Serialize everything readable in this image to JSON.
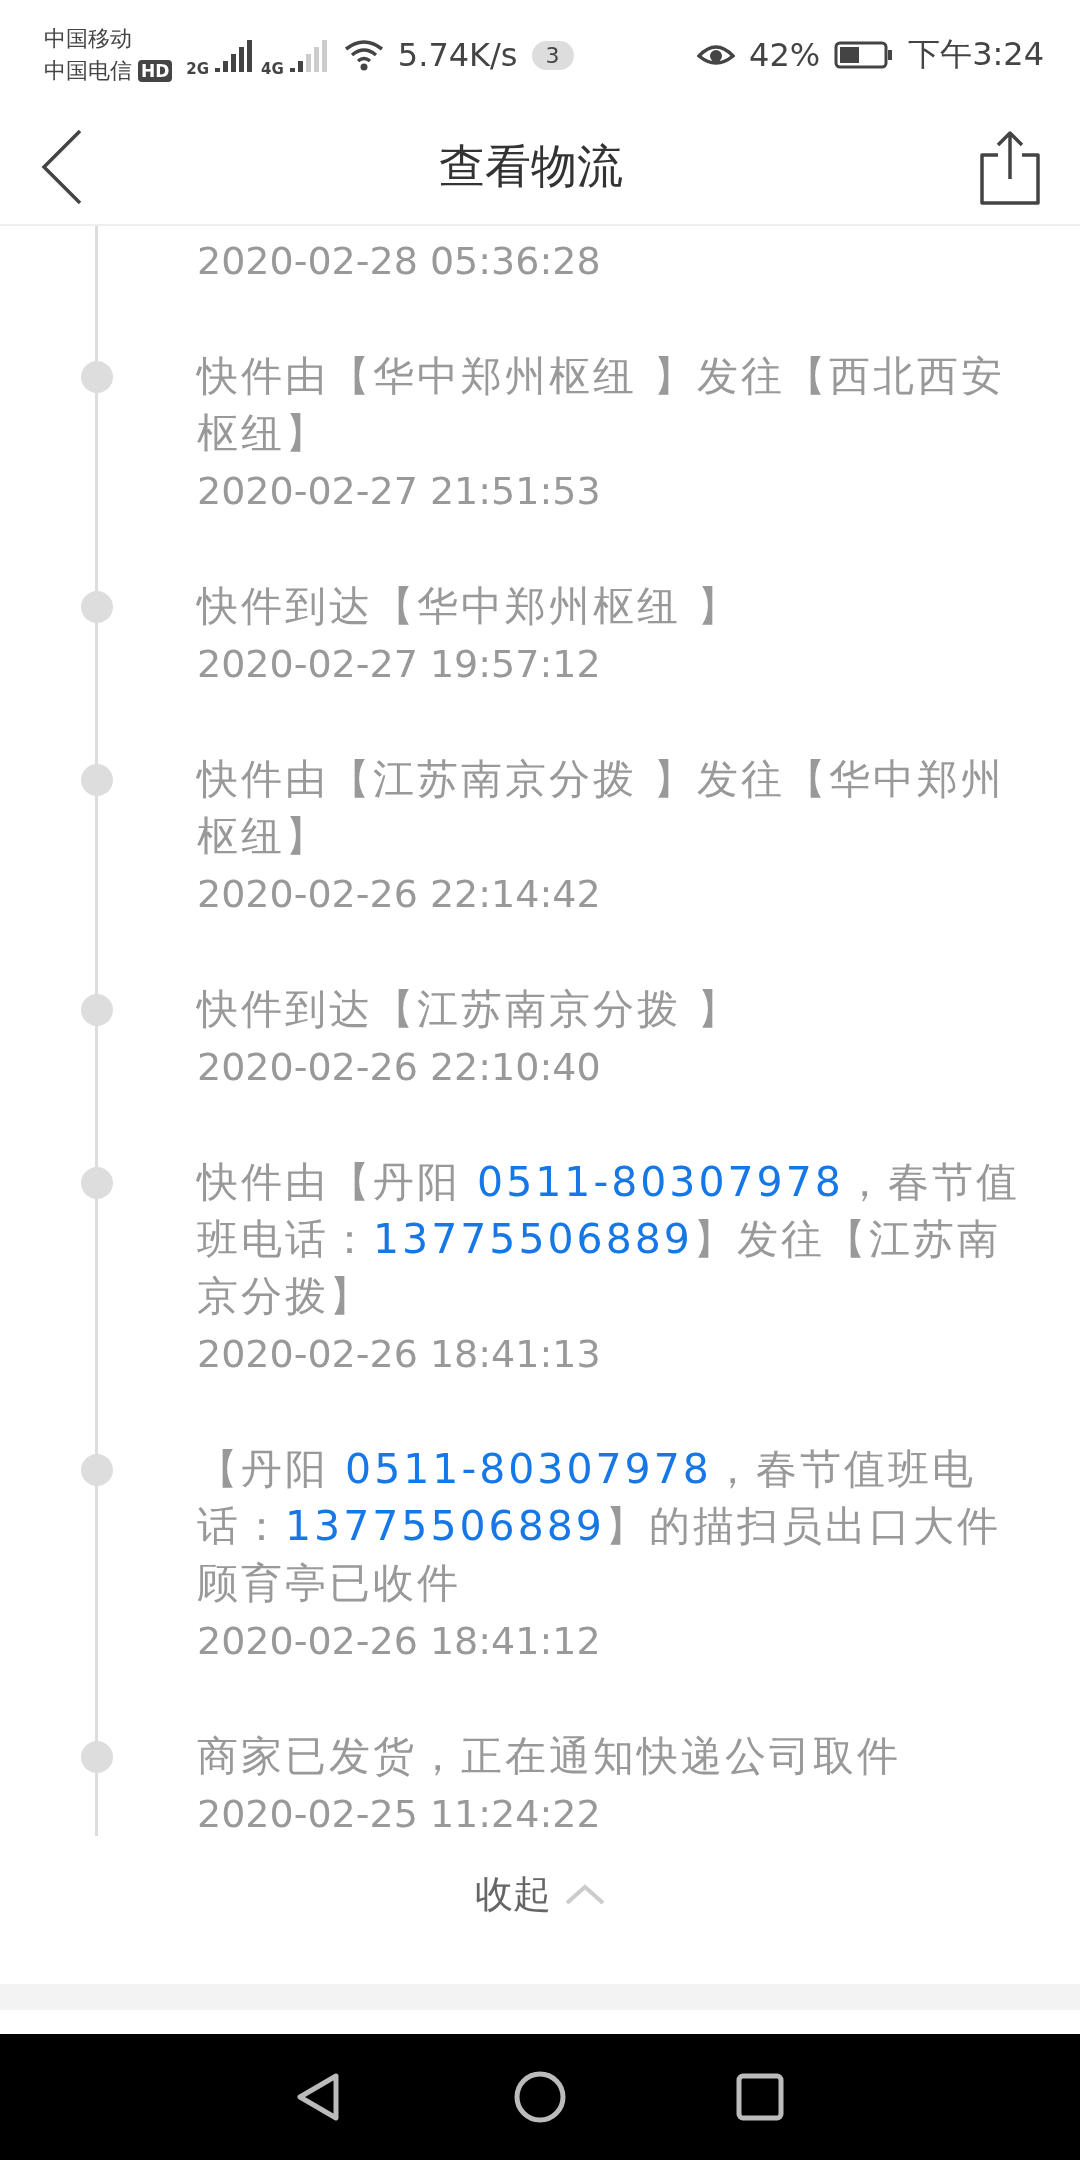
{
  "status_bar": {
    "carrier_1": "中国移动",
    "carrier_2": "中国电信",
    "hd_badge": "HD",
    "network_1": "2G",
    "network_2": "4G",
    "speed": "5.74K/s",
    "notification_count": "3",
    "battery": "42%",
    "time": "下午3:24"
  },
  "header": {
    "title": "查看物流"
  },
  "events": [
    {
      "kind": "cut",
      "time": "2020-02-28 05:36:28"
    },
    {
      "kind": "event",
      "text": [
        {
          "t": "快件由【华中郑州枢纽 】发往【西北西安枢纽】"
        }
      ],
      "time": "2020-02-27 21:51:53"
    },
    {
      "kind": "event",
      "text": [
        {
          "t": "快件到达【华中郑州枢纽 】"
        }
      ],
      "time": "2020-02-27 19:57:12"
    },
    {
      "kind": "event",
      "text": [
        {
          "t": "快件由【江苏南京分拨 】发往【华中郑州枢纽】"
        }
      ],
      "time": "2020-02-26 22:14:42"
    },
    {
      "kind": "event",
      "text": [
        {
          "t": "快件到达【江苏南京分拨 】"
        }
      ],
      "time": "2020-02-26 22:10:40"
    },
    {
      "kind": "event",
      "text": [
        {
          "t": "快件由【丹阳 "
        },
        {
          "t": "0511-80307978",
          "link": true
        },
        {
          "t": "，春节值班电话："
        },
        {
          "t": "13775506889",
          "link": true
        },
        {
          "t": "】发往【江苏南京分拨】"
        }
      ],
      "time": "2020-02-26 18:41:13"
    },
    {
      "kind": "event",
      "text": [
        {
          "t": "【丹阳 "
        },
        {
          "t": "0511-80307978",
          "link": true
        },
        {
          "t": "，春节值班电话："
        },
        {
          "t": "13775506889",
          "link": true
        },
        {
          "t": "】的描扫员出口大件顾育亭已收件"
        }
      ],
      "time": "2020-02-26 18:41:12"
    },
    {
      "kind": "event",
      "text": [
        {
          "t": "商家已发货，正在通知快递公司取件"
        }
      ],
      "time": "2020-02-25 11:24:22"
    }
  ],
  "collapse": {
    "label": "收起"
  }
}
